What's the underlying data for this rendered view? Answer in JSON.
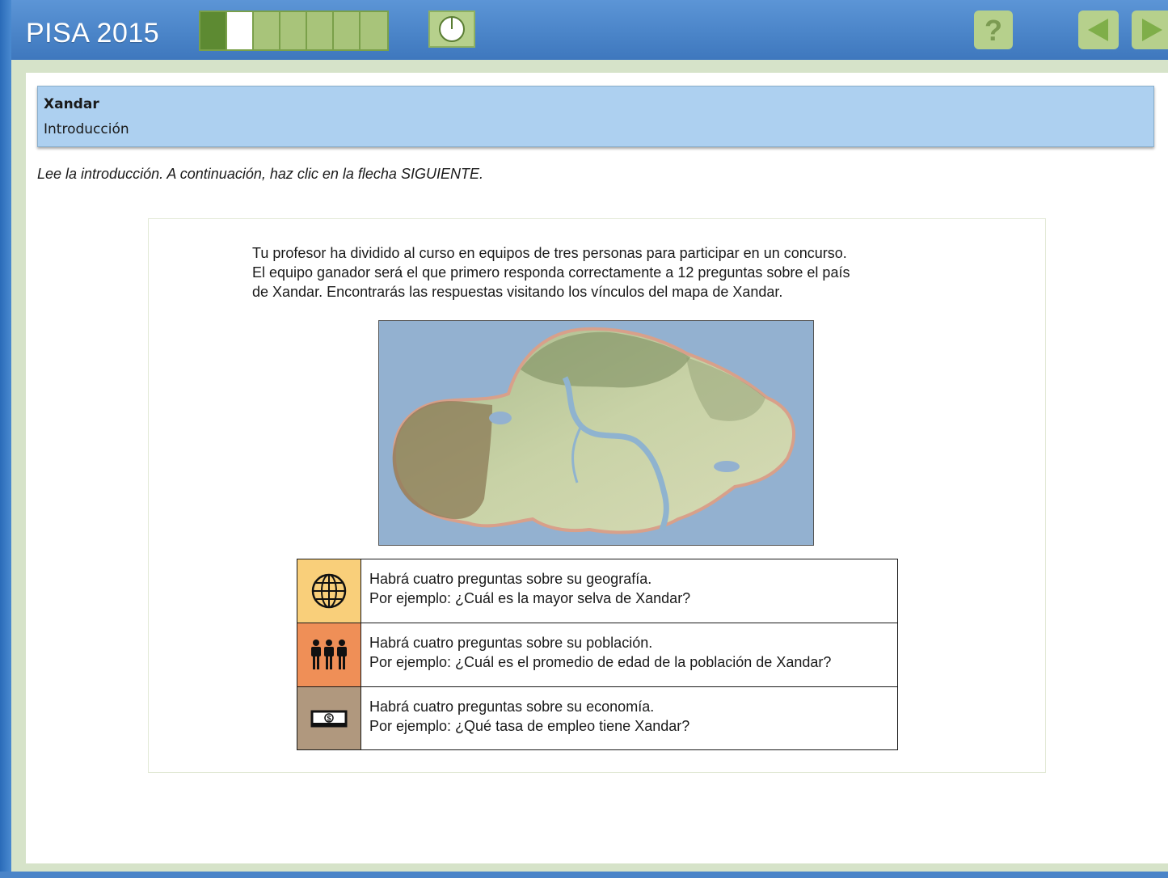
{
  "app": {
    "title": "PISA 2015"
  },
  "progress": {
    "total_segments": 7,
    "completed_segments": 1,
    "current_segment": 2
  },
  "nav": {
    "timer_icon": "clock-icon",
    "help_icon": "help-icon",
    "prev_icon": "arrow-left-icon",
    "next_icon": "arrow-right-icon"
  },
  "unit": {
    "title": "Xandar",
    "subtitle": "Introducción"
  },
  "instruction": "Lee la introducción. A continuación, haz clic en la flecha SIGUIENTE.",
  "stimulus": {
    "intro_lines": [
      "Tu profesor ha dividido al curso en equipos de tres personas para participar en un concurso.",
      "El equipo ganador será el que primero responda correctamente a 12 preguntas sobre el país",
      "de Xandar. Encontrarás las respuestas visitando los vínculos del mapa de Xandar."
    ],
    "topics": [
      {
        "icon": "globe-icon",
        "color": "#f9cf7a",
        "line1": "Habrá cuatro preguntas sobre su geografía.",
        "line2": "Por ejemplo: ¿Cuál es la mayor selva de Xandar?"
      },
      {
        "icon": "people-icon",
        "color": "#ef8f57",
        "line1": "Habrá cuatro preguntas sobre su población.",
        "line2": "Por ejemplo: ¿Cuál es el promedio de edad de la población de Xandar?"
      },
      {
        "icon": "money-icon",
        "color": "#b0987e",
        "line1": "Habrá cuatro preguntas sobre su economía.",
        "line2": "Por ejemplo: ¿Qué tasa de empleo tiene Xandar?"
      }
    ]
  },
  "colors": {
    "topbar": "#4a84c8",
    "button_green": "#b6d08c",
    "panel_blue": "#add0f0",
    "progress_done": "#5d8a32"
  }
}
